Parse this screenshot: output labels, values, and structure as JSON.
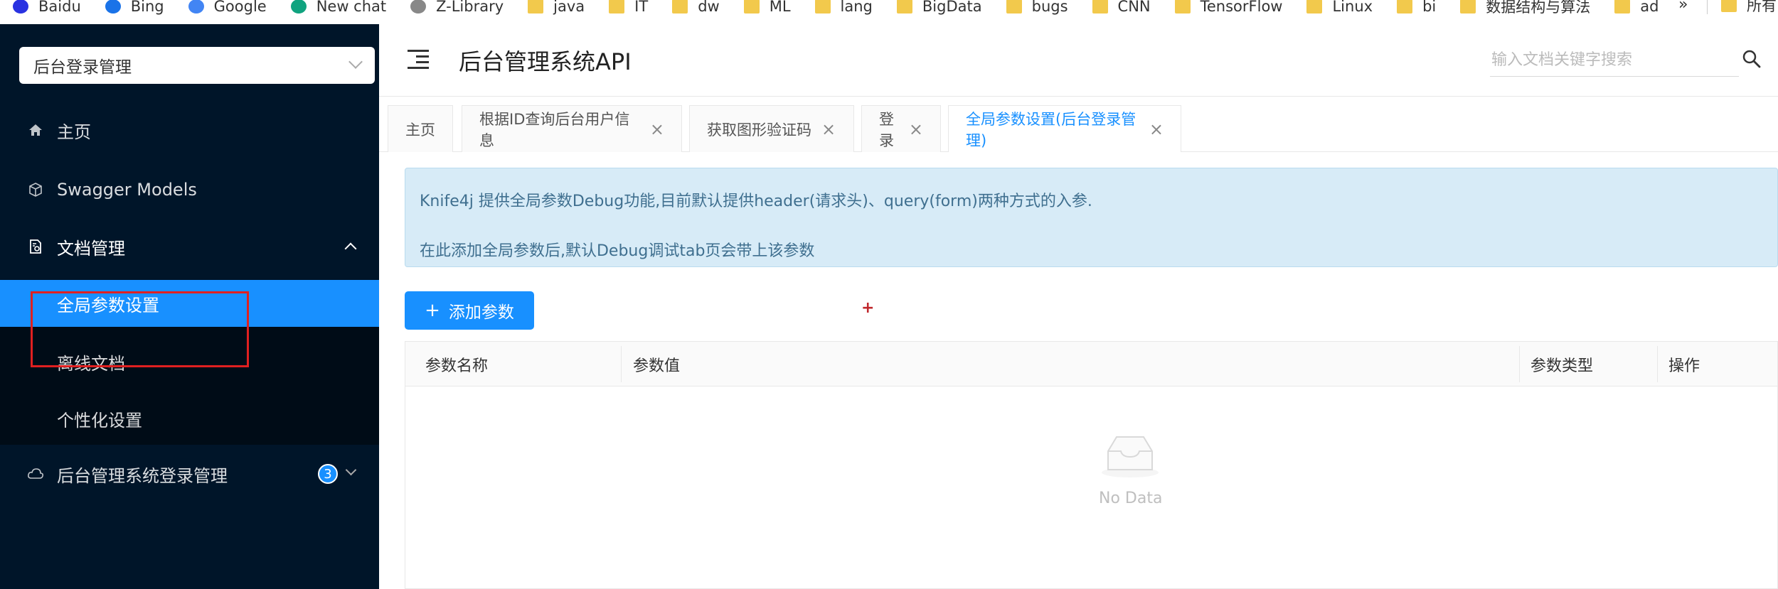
{
  "bookmarks": [
    {
      "label": "Baidu",
      "icon": "baidu-icon",
      "kind": "round",
      "color": "#2932e1"
    },
    {
      "label": "Bing",
      "icon": "bing-search-icon",
      "kind": "round",
      "color": "#1a73e8"
    },
    {
      "label": "Google",
      "icon": "google-icon",
      "kind": "round",
      "color": "#4285f4"
    },
    {
      "label": "New chat",
      "icon": "chatgpt-icon",
      "kind": "round",
      "color": "#10a37f"
    },
    {
      "label": "Z-Library",
      "icon": "zlibrary-icon",
      "kind": "round",
      "color": "#888888"
    },
    {
      "label": "java",
      "icon": "folder-icon",
      "kind": "folder"
    },
    {
      "label": "IT",
      "icon": "folder-icon",
      "kind": "folder"
    },
    {
      "label": "dw",
      "icon": "folder-icon",
      "kind": "folder"
    },
    {
      "label": "ML",
      "icon": "folder-icon",
      "kind": "folder"
    },
    {
      "label": "lang",
      "icon": "folder-icon",
      "kind": "folder"
    },
    {
      "label": "BigData",
      "icon": "folder-icon",
      "kind": "folder"
    },
    {
      "label": "bugs",
      "icon": "folder-icon",
      "kind": "folder"
    },
    {
      "label": "CNN",
      "icon": "folder-icon",
      "kind": "folder"
    },
    {
      "label": "TensorFlow",
      "icon": "folder-icon",
      "kind": "folder"
    },
    {
      "label": "Linux",
      "icon": "folder-icon",
      "kind": "folder"
    },
    {
      "label": "bi",
      "icon": "folder-icon",
      "kind": "folder"
    },
    {
      "label": "数据结构与算法",
      "icon": "folder-icon",
      "kind": "folder"
    },
    {
      "label": "ad",
      "icon": "folder-icon",
      "kind": "folder"
    }
  ],
  "bookmarks_overflow": "»",
  "bookmarks_all": "所有",
  "sidebar": {
    "project_select": "后台登录管理",
    "items": [
      {
        "label": "主页",
        "icon": "home-icon"
      },
      {
        "label": "Swagger Models",
        "icon": "cube-icon"
      },
      {
        "label": "文档管理",
        "icon": "document-settings-icon"
      },
      {
        "label": "全局参数设置"
      },
      {
        "label": "离线文档"
      },
      {
        "label": "个性化设置"
      },
      {
        "label": "后台管理系统登录管理",
        "icon": "cloud-icon",
        "badge": "3"
      }
    ]
  },
  "header": {
    "title": "后台管理系统API",
    "search_placeholder": "输入文档关键字搜索"
  },
  "tabs": [
    {
      "label": "主页"
    },
    {
      "label": "根据ID查询后台用户信息"
    },
    {
      "label": "获取图形验证码"
    },
    {
      "label": "登录"
    },
    {
      "label": "全局参数设置(后台登录管理)"
    }
  ],
  "tab_close": "×",
  "alert": {
    "line1": "Knife4j 提供全局参数Debug功能,目前默认提供header(请求头)、query(form)两种方式的入参.",
    "line2": "在此添加全局参数后,默认Debug调试tab页会带上该参数"
  },
  "add_button": {
    "icon": "+",
    "label": "添加参数"
  },
  "red_plus": "+",
  "table": {
    "columns": [
      "参数名称",
      "参数值",
      "参数类型",
      "操作"
    ],
    "empty_text": "No Data"
  },
  "colors": {
    "primary": "#1890ff",
    "sidebar": "#001529",
    "highlight": "#e02020"
  }
}
